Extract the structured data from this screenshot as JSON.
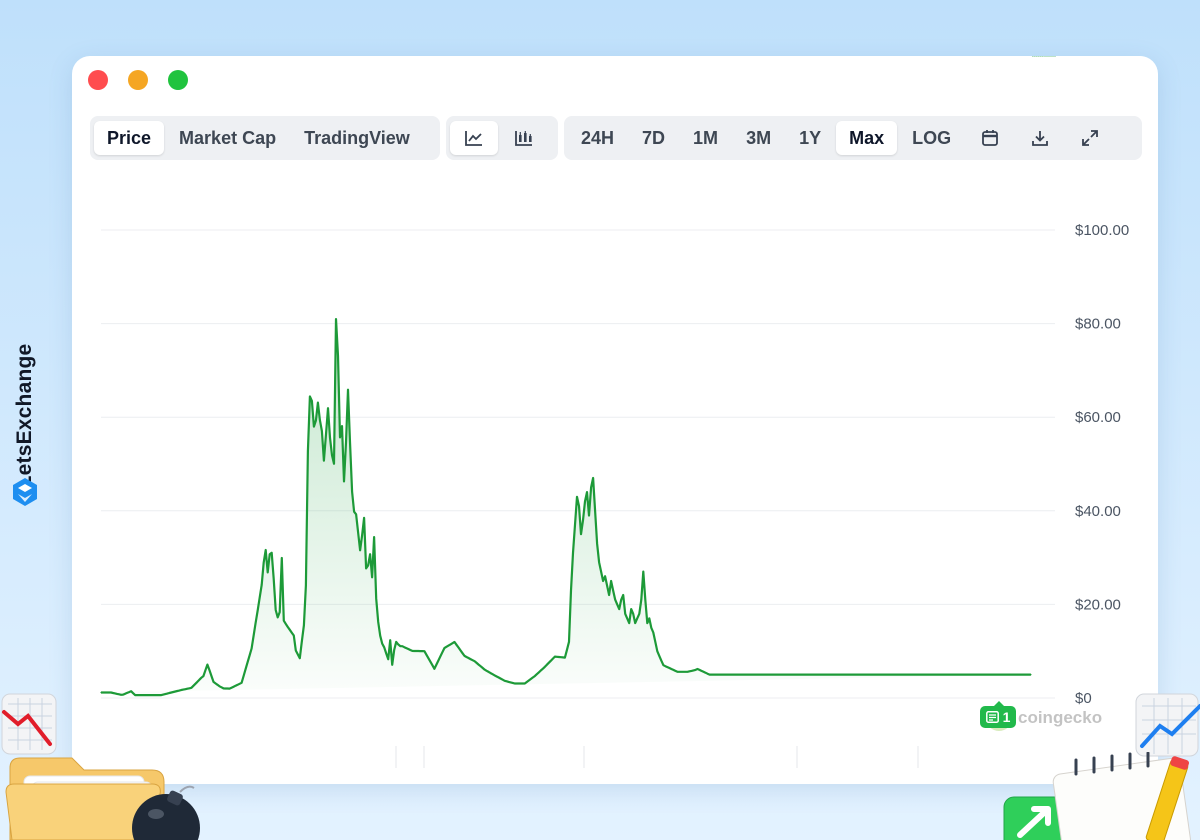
{
  "brand": {
    "name": "LetsExchange"
  },
  "window_controls": [
    "close",
    "minimize",
    "maximize"
  ],
  "view_tabs": [
    {
      "label": "Price",
      "active": true
    },
    {
      "label": "Market Cap",
      "active": false
    },
    {
      "label": "TradingView",
      "active": false
    }
  ],
  "chart_type_buttons": [
    {
      "icon": "line-chart-icon",
      "active": true
    },
    {
      "icon": "candlestick-chart-icon",
      "active": false
    }
  ],
  "ranges": [
    {
      "label": "24H",
      "active": false
    },
    {
      "label": "7D",
      "active": false
    },
    {
      "label": "1M",
      "active": false
    },
    {
      "label": "3M",
      "active": false
    },
    {
      "label": "1Y",
      "active": false
    },
    {
      "label": "Max",
      "active": true
    },
    {
      "label": "LOG",
      "active": false
    }
  ],
  "tool_buttons": [
    {
      "icon": "calendar-icon"
    },
    {
      "icon": "download-icon"
    },
    {
      "icon": "expand-icon"
    }
  ],
  "watermark": "coingecko",
  "news_badge": {
    "count": "1"
  },
  "colors": {
    "line": "#1d9a38",
    "accent": "#21b94b",
    "background": "#cfe8fd"
  },
  "chart_data": {
    "type": "area",
    "x": [
      0,
      2,
      4,
      6,
      8,
      10,
      12,
      14,
      16,
      18,
      20,
      22,
      24,
      26,
      28,
      30,
      32,
      34,
      36,
      38,
      40,
      42,
      44,
      46,
      48,
      50,
      52,
      54,
      56,
      58,
      60,
      62,
      64,
      66,
      68,
      70,
      72,
      74,
      76,
      78,
      80,
      82,
      84,
      86,
      88,
      90,
      92,
      94,
      96,
      98,
      100,
      102,
      104,
      106,
      108,
      110,
      112,
      114,
      116,
      118,
      120,
      122,
      124,
      126,
      128,
      130,
      132,
      134,
      136,
      138,
      140,
      142,
      144,
      146,
      148,
      150,
      152,
      154,
      156,
      158,
      160,
      162,
      164,
      166,
      168,
      170,
      172,
      174,
      176,
      178,
      180,
      182,
      184,
      186,
      188,
      190,
      192,
      194,
      196,
      198,
      200,
      202,
      204,
      206,
      208,
      210,
      212,
      214,
      216,
      218,
      220,
      222,
      224,
      226,
      228,
      230,
      232,
      234,
      236,
      238,
      240,
      242,
      244,
      246,
      248,
      250,
      252,
      254,
      256,
      258,
      260,
      262,
      264,
      266,
      268,
      270,
      272,
      274,
      276,
      278,
      280,
      282,
      284,
      286,
      288,
      290,
      292,
      294,
      296,
      298,
      300,
      302,
      304,
      306,
      308,
      310,
      312,
      314,
      316,
      318,
      320,
      322,
      324,
      326,
      328,
      330,
      332,
      334,
      336,
      338,
      340,
      342,
      344,
      346,
      348,
      350,
      352,
      354,
      356,
      358,
      360,
      362,
      364,
      366,
      368,
      370,
      372,
      374,
      376,
      378,
      380,
      382,
      384,
      386,
      388,
      390,
      392,
      394,
      396,
      398,
      400,
      402,
      404,
      406,
      408,
      410,
      412,
      414,
      416,
      418,
      420,
      422,
      424,
      426,
      428,
      430,
      432,
      434,
      436,
      438,
      440,
      442,
      444,
      446,
      448,
      450,
      452,
      454,
      456,
      458,
      460,
      462,
      464,
      466,
      468,
      470,
      472,
      474,
      476,
      478,
      480,
      482,
      484,
      486,
      488,
      490,
      492,
      494,
      496,
      498,
      500,
      502,
      504,
      506,
      508,
      510,
      512,
      514,
      516,
      518,
      520,
      522,
      524,
      526,
      528,
      530,
      532,
      534,
      536,
      538,
      540,
      542,
      544,
      546,
      548,
      550,
      552,
      554,
      556,
      558,
      560,
      562,
      564,
      566,
      568,
      570,
      572,
      574,
      576,
      578,
      580,
      582,
      584,
      586,
      588,
      590,
      592,
      594,
      596,
      598,
      600,
      602,
      604,
      606,
      608,
      610,
      612,
      614,
      616,
      618,
      620,
      622,
      624,
      626,
      628,
      630,
      632,
      634,
      636,
      638,
      640,
      642,
      644,
      646,
      648,
      650,
      652,
      654,
      656,
      658,
      660,
      662,
      664,
      666,
      668,
      670,
      672,
      674,
      676,
      678,
      680,
      682,
      684,
      686,
      688,
      690,
      692,
      694,
      696,
      698,
      700,
      702,
      704,
      706,
      708,
      710,
      712,
      714,
      716,
      718,
      720,
      722,
      724,
      726,
      728,
      730,
      732,
      734,
      736,
      738,
      740,
      742,
      744,
      746,
      748,
      750,
      752,
      754,
      756,
      758,
      760,
      762,
      764,
      766,
      768,
      770,
      772,
      774,
      776,
      778,
      780,
      782,
      784,
      786,
      788,
      790,
      792,
      794,
      796,
      798,
      800,
      802,
      804,
      806,
      808,
      810,
      812,
      814,
      816,
      818,
      820,
      822,
      824,
      826,
      828,
      830,
      832,
      834,
      836,
      838,
      840,
      842,
      844,
      846,
      848,
      850,
      852,
      854,
      856,
      858,
      860,
      862,
      864,
      866,
      868,
      870,
      872,
      874,
      876,
      878,
      880,
      882,
      884,
      886,
      888,
      890,
      892,
      894,
      896,
      898,
      900,
      902,
      904,
      906,
      908,
      910,
      912,
      914,
      916,
      918,
      920,
      922,
      924,
      926,
      928,
      930,
      932,
      934,
      936,
      938,
      940,
      942,
      944,
      946,
      948,
      950
    ],
    "values": [
      1.17,
      1.17,
      1.17,
      1.17,
      1.17,
      1.17,
      1.07,
      0.98,
      0.88,
      0.78,
      0.68,
      0.72,
      0.9,
      1.09,
      1.27,
      1.46,
      1.03,
      0.61,
      0.61,
      0.61,
      0.61,
      0.61,
      0.61,
      0.61,
      0.61,
      0.61,
      0.61,
      0.61,
      0.61,
      0.61,
      0.61,
      0.72,
      0.83,
      0.95,
      1.06,
      1.17,
      1.28,
      1.38,
      1.49,
      1.59,
      1.7,
      1.79,
      1.89,
      1.98,
      2.07,
      2.17,
      2.6,
      3.04,
      3.47,
      3.91,
      4.34,
      4.67,
      5.91,
      7.14,
      5.91,
      4.67,
      3.43,
      3.12,
      2.81,
      2.5,
      2.28,
      2.06,
      2.04,
      2.02,
      2.0,
      2.21,
      2.42,
      2.62,
      2.83,
      3.04,
      3.24,
      4.71,
      6.17,
      7.64,
      9.11,
      10.58,
      13.3,
      16.02,
      18.75,
      21.47,
      24.19,
      28.96,
      31.62,
      26.84,
      30.7,
      31.03,
      25.47,
      18.8,
      17.22,
      18.35,
      29.91,
      16.51,
      15.84,
      15.17,
      14.57,
      13.96,
      13.36,
      10.15,
      9.32,
      8.5,
      12.02,
      15.54,
      24.07,
      52.78,
      64.42,
      63.48,
      57.99,
      59.3,
      63.13,
      59.38,
      57.03,
      50.7,
      56.12,
      61.93,
      55.59,
      51.87,
      50.07,
      80.96,
      73.09,
      55.69,
      58.1,
      46.29,
      54.64,
      65.88,
      54.67,
      44.05,
      39.8,
      39.26,
      35.42,
      31.56,
      34.74,
      38.51,
      27.7,
      28.31,
      30.72,
      25.78,
      34.37,
      21.23,
      16.27,
      13.32,
      11.63,
      10.84,
      9.53,
      8.28,
      12.36,
      7.1,
      10.28,
      11.99,
      11.46,
      11.08,
      11.07,
      10.86,
      10.66,
      10.46,
      10.26,
      10.06,
      10.05,
      10.04,
      10.04,
      10.03,
      10.02,
      10.01,
      9.26,
      8.5,
      7.75,
      7.0,
      6.25,
      7.13,
      8.02,
      8.9,
      9.79,
      10.67,
      10.93,
      11.19,
      11.45,
      11.71,
      11.97,
      11.37,
      10.78,
      10.18,
      9.58,
      8.99,
      8.76,
      8.54,
      8.31,
      8.08,
      7.86,
      7.5,
      7.14,
      6.79,
      6.43,
      6.07,
      5.82,
      5.58,
      5.33,
      5.08,
      4.83,
      4.6,
      4.37,
      4.14,
      3.91,
      3.68,
      3.56,
      3.45,
      3.33,
      3.22,
      3.1,
      3.1,
      3.1,
      3.1,
      3.1,
      3.1,
      3.42,
      3.73,
      4.05,
      4.37,
      4.69,
      5.08,
      5.48,
      5.88,
      6.27,
      6.67,
      7.11,
      7.54,
      7.98,
      8.41,
      8.85,
      8.81,
      8.77,
      8.72,
      8.68,
      8.64,
      10.32,
      12.0,
      23.0,
      31.0,
      37.0,
      43.0,
      41.0,
      35.0,
      38.0,
      42.0,
      44.0,
      39.0,
      45.0,
      47.0,
      40.0,
      33.0,
      29.0,
      27.0,
      25.0,
      26.0,
      24.0,
      22.0,
      25.0,
      23.0,
      21.0,
      20.0,
      19.0,
      21.0,
      22.0,
      18.0,
      17.0,
      16.0,
      19.0,
      18.0,
      16.0,
      17.0,
      18.0,
      21.0,
      27.0,
      21.0,
      16.0,
      17.0,
      15.0,
      14.0,
      12.0,
      10.0,
      9.0,
      8.0,
      7.0,
      6.8,
      6.6,
      6.4,
      6.2,
      6.0,
      5.8,
      5.6,
      5.6,
      5.6,
      5.6,
      5.6,
      5.6,
      5.7,
      5.8,
      5.9,
      6.0,
      6.2,
      6.0,
      5.8,
      5.6,
      5.4,
      5.2,
      5.0,
      5.0,
      5.0,
      5.0,
      5.0,
      5.0,
      5.0,
      5.0,
      5.0,
      5.0,
      5.0,
      5.0,
      5.0,
      5.0,
      5.0,
      5.0,
      5.0,
      5.0,
      5.0,
      5.0,
      5.0,
      5.0,
      5.0,
      5.0,
      5.0,
      5.0,
      5.0,
      5.0,
      5.0,
      5.0,
      5.0,
      5.0,
      5.0,
      5.0,
      5.0,
      5.0,
      5.0,
      5.0,
      5.0,
      5.0,
      5.0,
      5.0,
      5.0,
      5.0,
      5.0,
      5.0,
      5.0,
      5.0,
      5.0,
      5.0,
      5.0,
      5.0,
      5.0,
      5.0,
      5.0,
      5.0,
      5.0,
      5.0,
      5.0,
      5.0,
      5.0,
      5.0,
      5.0,
      5.0,
      5.0,
      5.0,
      5.0,
      5.0,
      5.0,
      5.0,
      5.0,
      5.0,
      5.0,
      5.0,
      5.0,
      5.0,
      5.0,
      5.0,
      5.0,
      5.0,
      5.0,
      5.0,
      5.0,
      5.0,
      5.0,
      5.0,
      5.0,
      5.0,
      5.0,
      5.0,
      5.0,
      5.0,
      5.0,
      5.0,
      5.0,
      5.0,
      5.0,
      5.0,
      5.0,
      5.0,
      5.0,
      5.0,
      5.0,
      5.0,
      5.0,
      5.0,
      5.0,
      5.0,
      5.0,
      5.0,
      5.0,
      5.0,
      5.0,
      5.0,
      5.0,
      5.0,
      5.0,
      5.0,
      5.0,
      5.0,
      5.0,
      5.0,
      5.0,
      5.0,
      5.0,
      5.0,
      5.0,
      5.0,
      5.0,
      5.0,
      5.0,
      5.0,
      5.0,
      5.0,
      5.0,
      5.0,
      5.0,
      5.0,
      5.0,
      5.0,
      5.0,
      5.0,
      5.0,
      5.0,
      5.0,
      5.0,
      5.0,
      5.0,
      5.0,
      5.0,
      5.0,
      5.0,
      5.0,
      5.0,
      5.0,
      5.0,
      5.0,
      5.0,
      5.0,
      5.0,
      5.0
    ],
    "yticks": [
      "$0",
      "$20.00",
      "$40.00",
      "$60.00",
      "$80.00",
      "$100.00"
    ],
    "ytick_values": [
      0,
      20,
      40,
      60,
      80,
      100
    ],
    "ylim": [
      0,
      100
    ],
    "xlim": [
      0,
      950
    ],
    "grid": true,
    "fill": "gradient"
  }
}
